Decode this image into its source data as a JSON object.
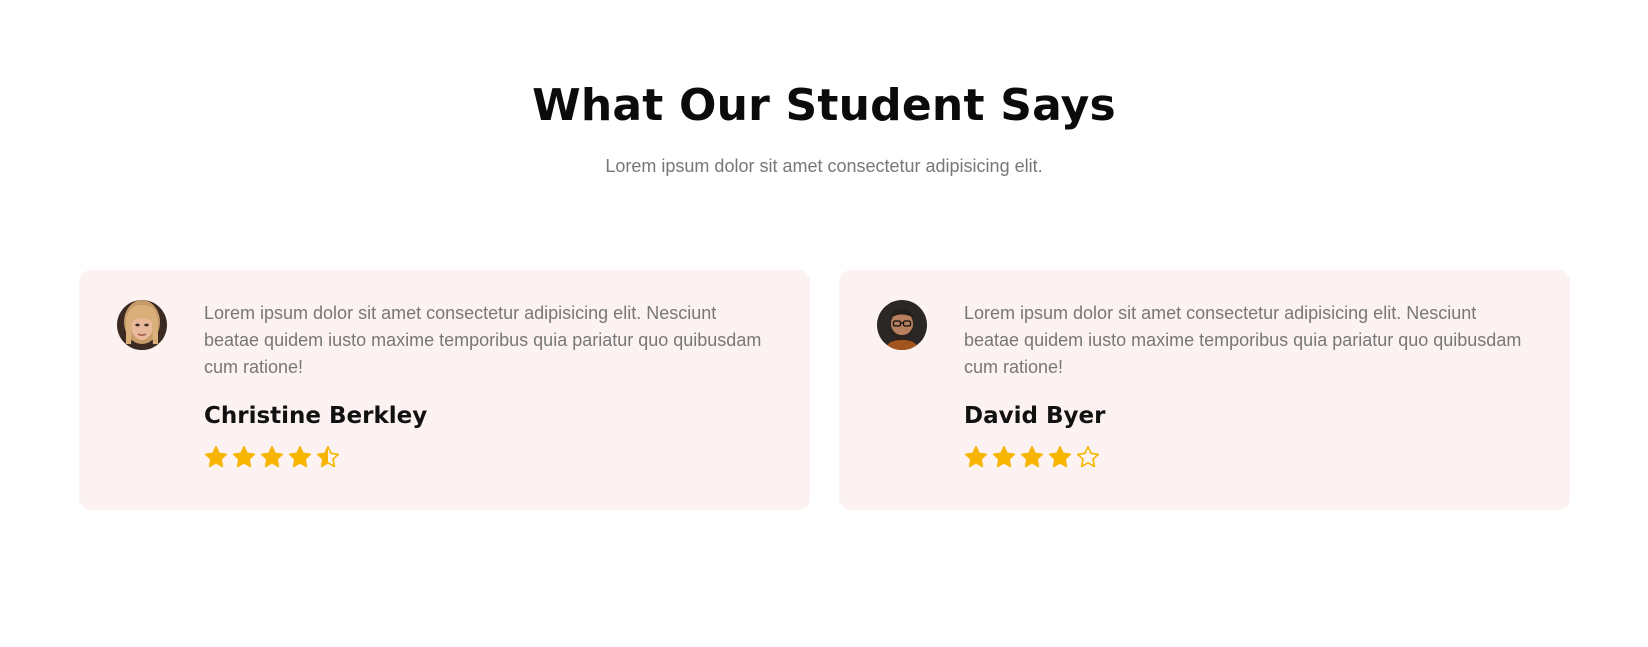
{
  "section": {
    "title": "What Our Student Says",
    "subtitle": "Lorem ipsum dolor sit amet consectetur adipisicing elit."
  },
  "colors": {
    "card_background": "#fdf2f2",
    "star": "#f7b500",
    "title": "#0b0b0b",
    "muted_text": "#777777"
  },
  "testimonials": [
    {
      "avatar_icon": "avatar-woman-photo",
      "quote": "Lorem ipsum dolor sit amet consectetur adipisicing elit. Nesciunt beatae quidem iusto maxime temporibus quia pariatur quo quibusdam cum ratione!",
      "name": "Christine Berkley",
      "rating": 4.5,
      "rating_max": 5
    },
    {
      "avatar_icon": "avatar-man-photo",
      "quote": "Lorem ipsum dolor sit amet consectetur adipisicing elit. Nesciunt beatae quidem iusto maxime temporibus quia pariatur quo quibusdam cum ratione!",
      "name": "David Byer",
      "rating": 4,
      "rating_max": 5
    }
  ]
}
